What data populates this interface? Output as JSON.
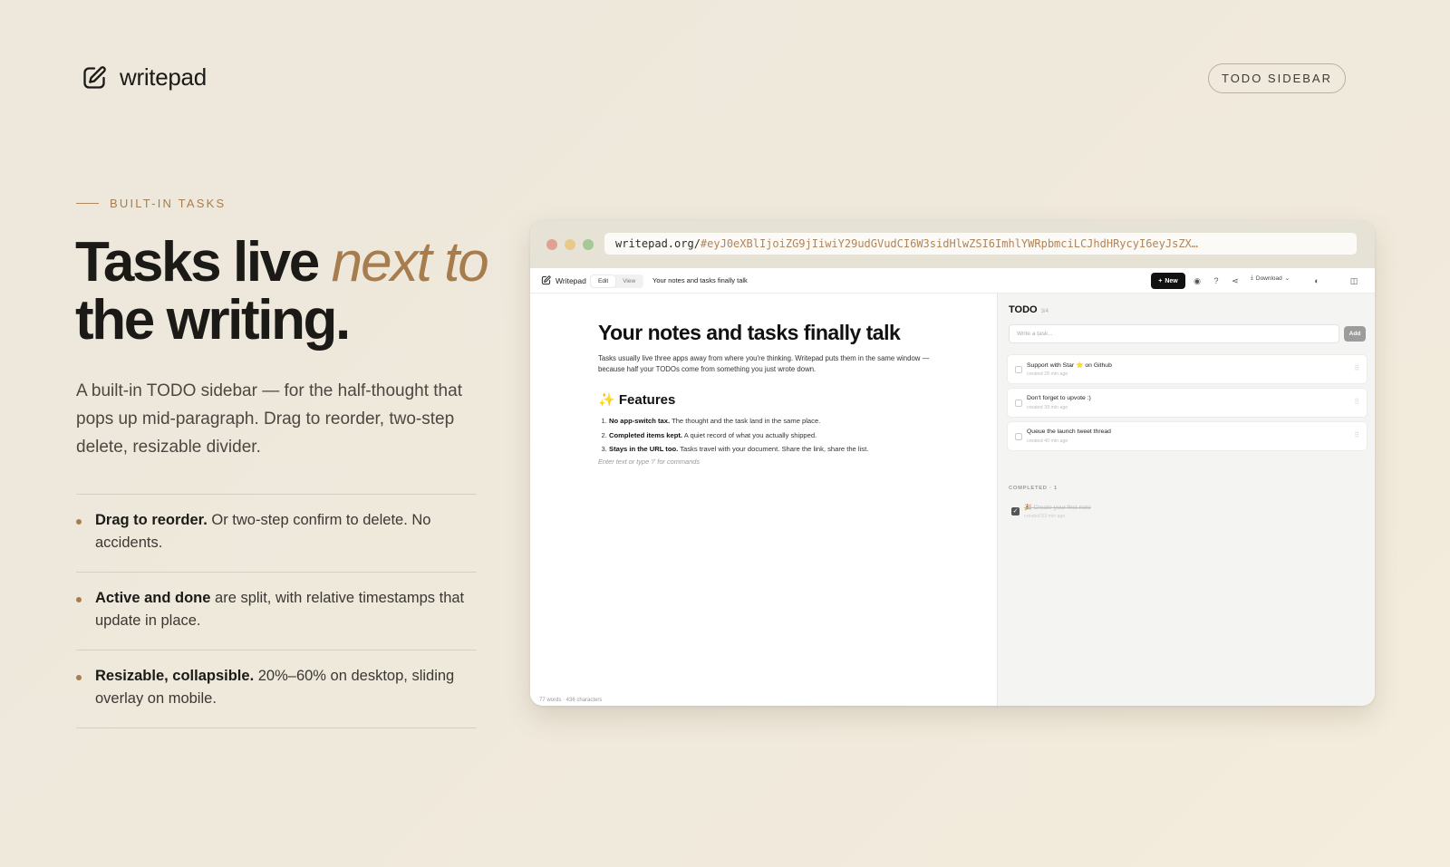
{
  "brand": {
    "name": "writepad",
    "icon": "pencil-edit-icon"
  },
  "badge": "TODO SIDEBAR",
  "eyebrow": "BUILT-IN TASKS",
  "headline": {
    "part1": "Tasks live ",
    "accent": "next to",
    "part2": "the writing."
  },
  "lede": "A built-in TODO sidebar — for the half-thought that pops up mid-paragraph. Drag to reorder, two-step delete, resizable divider.",
  "features": [
    {
      "bold": "Drag to reorder.",
      "text": " Or two-step confirm to delete. No accidents."
    },
    {
      "bold": "Active and done",
      "text": " are split, with relative timestamps that update in place."
    },
    {
      "bold": "Resizable, collapsible.",
      "text": " 20%–60% on desktop, sliding overlay on mobile."
    }
  ],
  "colors": {
    "accent": "#a77d4e",
    "traffic_red": "#e0a195",
    "traffic_yellow": "#e8c989",
    "traffic_green": "#a6c896"
  },
  "browser": {
    "url_host": "writepad.org/",
    "url_hash": "#eyJ0eXBlIjoiZG9jIiwiY29udGVudCI6W3sidHlwZSI6ImhlYWRpbmciLCJhdHRycyI6eyJsZX…"
  },
  "app": {
    "brand": "Writepad",
    "modes": [
      "Edit",
      "View"
    ],
    "doc_title": "Your notes and tasks finally talk",
    "new_label": "New",
    "download_label": "Download",
    "heading": "Your notes and tasks finally talk",
    "intro": "Tasks usually live three apps away from where you're thinking. Writepad puts them in the same window — because half your TODOs come from something you just wrote down.",
    "features_heading": "✨ Features",
    "list": [
      {
        "bold": "No app-switch tax.",
        "text": " The thought and the task land in the same place."
      },
      {
        "bold": "Completed items kept.",
        "text": " A quiet record of what you actually shipped."
      },
      {
        "bold": "Stays in the URL too.",
        "text": " Tasks travel with your document. Share the link, share the list."
      }
    ],
    "placeholder_hint": "Enter text or type '/' for commands",
    "status": "77 words · 436 characters"
  },
  "todo": {
    "title": "TODO",
    "count": "3/4",
    "input_placeholder": "Write a task...",
    "add_label": "Add",
    "tasks": [
      {
        "text": "Support with Star ⭐ on Github",
        "meta": "created 28 min ago"
      },
      {
        "text": "Don't forget to upvote :)",
        "meta": "created 39 min ago"
      },
      {
        "text": "Queue the launch tweet thread",
        "meta": "created 40 min ago"
      }
    ],
    "completed_label": "COMPLETED · 1",
    "completed": [
      {
        "text": "🎉 Create your first note",
        "meta": "created 53 min ago"
      }
    ]
  }
}
